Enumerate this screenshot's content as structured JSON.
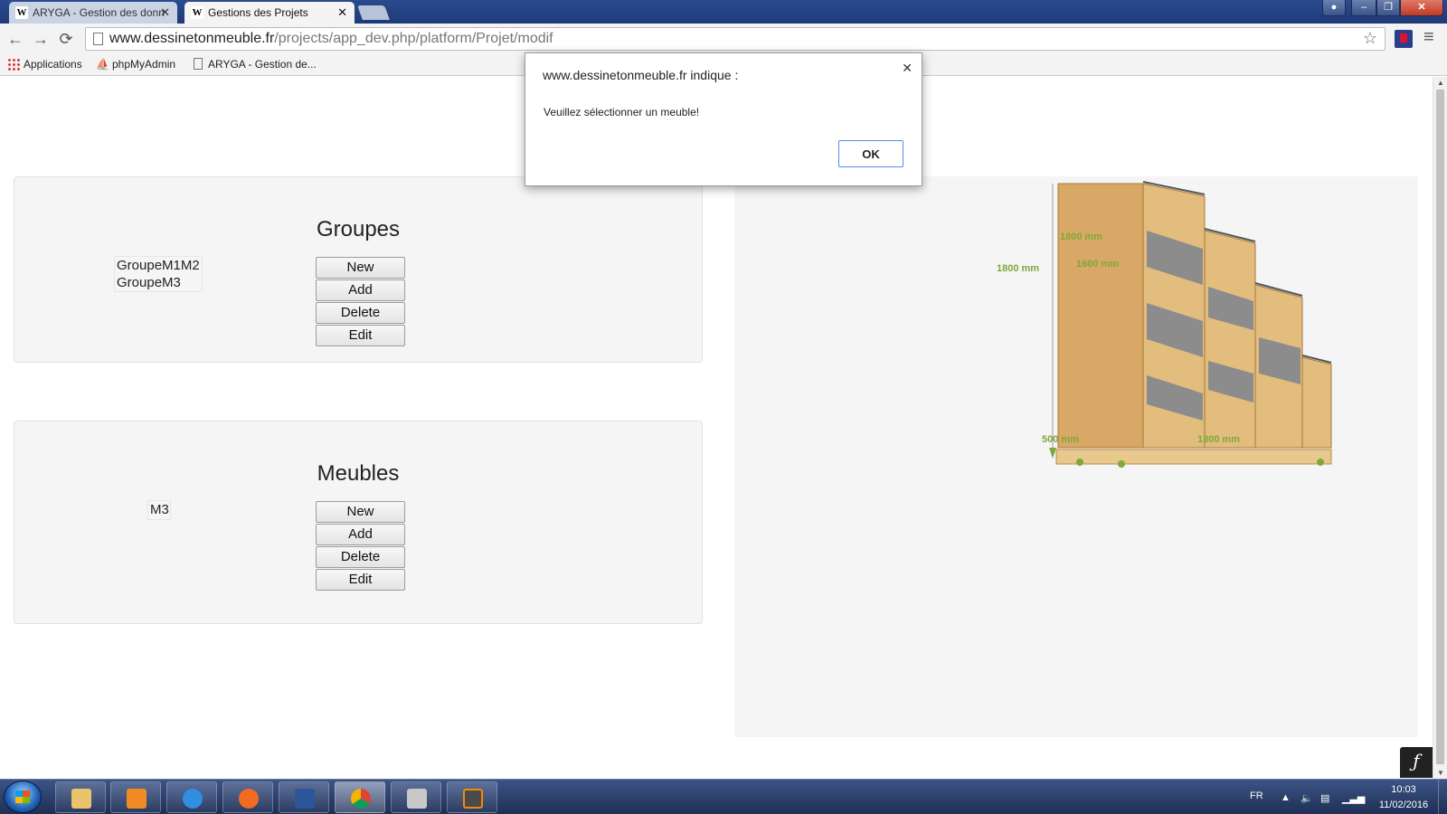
{
  "browser": {
    "tabs": [
      {
        "title": "ARYGA - Gestion des donn",
        "icon": "W"
      },
      {
        "title": "Gestions des Projets",
        "icon": "W"
      }
    ],
    "url_host": "www.dessinetonmeuble.fr",
    "url_path": "/projects/app_dev.php/platform/Projet/modif",
    "bookmarks": [
      "Applications",
      "phpMyAdmin",
      "ARYGA - Gestion de..."
    ]
  },
  "groupes": {
    "title": "Groupes",
    "items": [
      "GroupeM1M2",
      "GroupeM3"
    ],
    "buttons": {
      "new": "New",
      "add": "Add",
      "delete": "Delete",
      "edit": "Edit"
    }
  },
  "meubles": {
    "title": "Meubles",
    "items": [
      "M3"
    ],
    "buttons": {
      "new": "New",
      "add": "Add",
      "delete": "Delete",
      "edit": "Edit"
    }
  },
  "preview": {
    "dimensions": {
      "height_outer": "1800 mm",
      "height_inner": "1600 mm",
      "height_side": "1800 mm",
      "depth": "500 mm",
      "width": "1800 mm"
    },
    "colors": {
      "wood": "#e2bd7e",
      "wood_dark": "#c99a55",
      "dim": "#7fa83a"
    }
  },
  "dialog": {
    "title": "www.dessinetonmeuble.fr indique :",
    "message": "Veuillez sélectionner un meuble!",
    "ok": "OK"
  },
  "taskbar": {
    "lang": "FR",
    "time": "10:03",
    "date": "11/02/2016",
    "apps": [
      "file-explorer",
      "media-player",
      "internet-explorer",
      "firefox",
      "word",
      "chrome",
      "app",
      "sublime-text"
    ]
  }
}
